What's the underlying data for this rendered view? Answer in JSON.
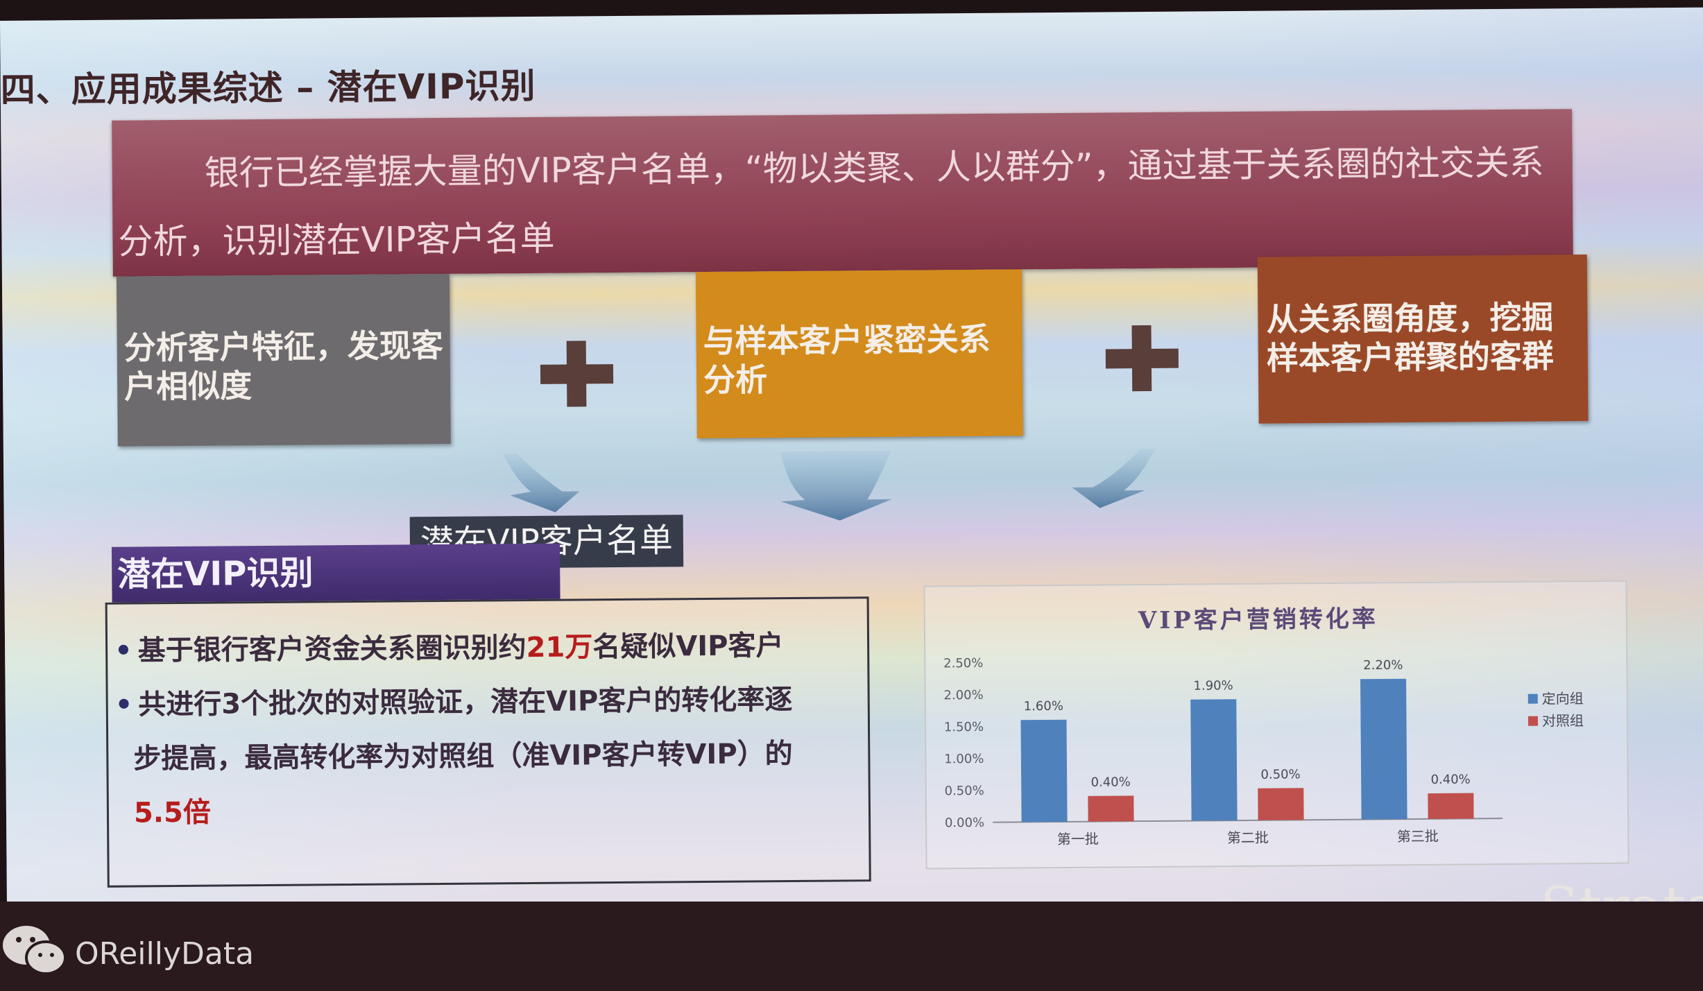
{
  "slide": {
    "title": "四、应用成果综述 – 潜在VIP识别",
    "intro": "银行已经掌握大量的VIP客户名单，“物以类聚、人以群分”，通过基于关系圈的社交关系分析，识别潜在VIP客户名单"
  },
  "steps": [
    {
      "label": "分析客户特征，发现客户相似度",
      "color": "#6d6b6e"
    },
    {
      "label": "与样本客户紧密关系分析",
      "color": "#d38b1c"
    },
    {
      "label": "从关系圈角度，挖掘样本客户群聚的客群",
      "color": "#9a4928"
    }
  ],
  "result_label": "潜在VIP客户名单",
  "vip_section": {
    "heading": "潜在VIP识别",
    "b1_pre": "基于银行客户资金关系圈识别约",
    "b1_hl": "21万",
    "b1_post": "名疑似VIP客户",
    "b2_line1": "共进行3个批次的对照验证，潜在VIP客户的转化率逐",
    "b2_line2": "步提高，最高转化率为对照组（准VIP客户转VIP）的",
    "b2_hl": "5.5倍"
  },
  "chart_data": {
    "type": "bar",
    "title": "VIP客户营销转化率",
    "categories": [
      "第一批",
      "第二批",
      "第三批"
    ],
    "series": [
      {
        "name": "定向组",
        "values": [
          1.6,
          1.9,
          2.2
        ],
        "labels": [
          "1.60%",
          "1.90%",
          "2.20%"
        ],
        "color": "#4f81bd"
      },
      {
        "name": "对照组",
        "values": [
          0.4,
          0.5,
          0.4
        ],
        "labels": [
          "0.40%",
          "0.50%",
          "0.40%"
        ],
        "color": "#c0504d"
      }
    ],
    "yticks": [
      "0.00%",
      "0.50%",
      "1.00%",
      "1.50%",
      "2.00%",
      "2.50%"
    ],
    "ylim": [
      0,
      2.5
    ],
    "legend": "right",
    "grid": false
  },
  "branding": {
    "strata": "Strata",
    "oreilly": "OReillyData"
  }
}
